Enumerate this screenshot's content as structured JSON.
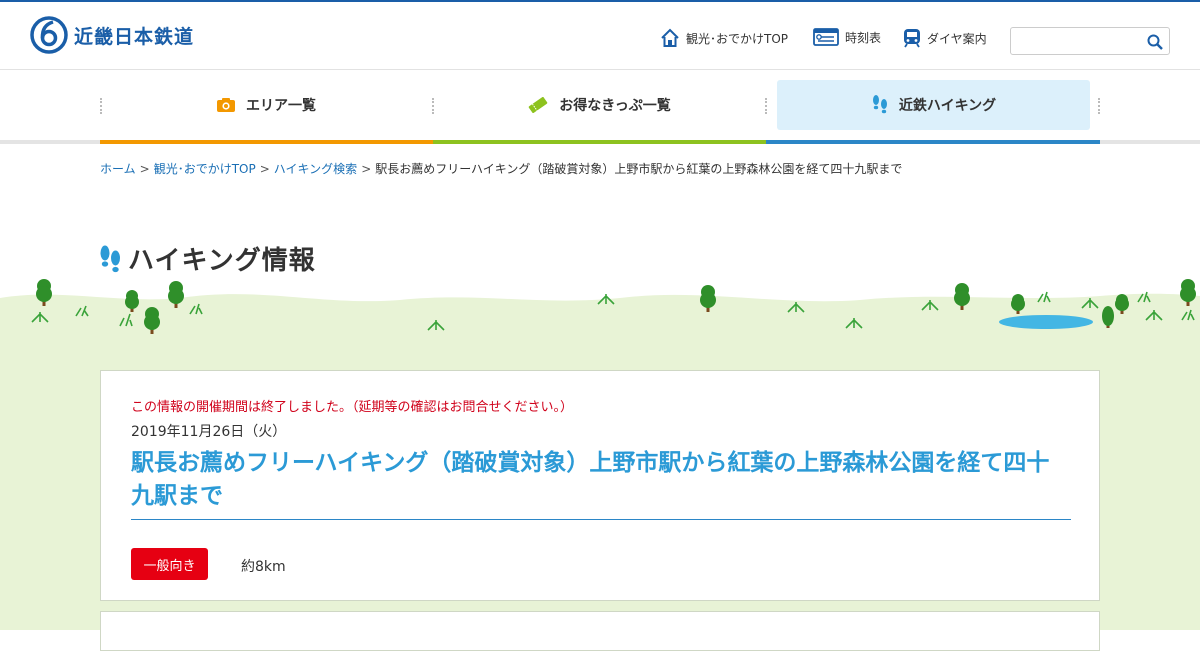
{
  "brand": {
    "name": "近畿日本鉄道"
  },
  "utility_nav": [
    {
      "label": "観光･おでかけTOP",
      "icon": "home-icon"
    },
    {
      "label": "時刻表",
      "icon": "timetable-icon"
    },
    {
      "label": "ダイヤ案内",
      "icon": "train-icon"
    }
  ],
  "search": {
    "placeholder": ""
  },
  "main_nav": [
    {
      "label": "エリア一覧",
      "icon": "camera-icon",
      "accent": "#f39800"
    },
    {
      "label": "お得なきっぷ一覧",
      "icon": "ticket-icon",
      "accent": "#8dc21f"
    },
    {
      "label": "近鉄ハイキング",
      "icon": "footprints-icon",
      "accent": "#2b86c7",
      "active": true
    }
  ],
  "breadcrumb": {
    "links": [
      "ホーム",
      "観光･おでかけTOP",
      "ハイキング検索"
    ],
    "current": "駅長お薦めフリーハイキング（踏破賞対象）上野市駅から紅葉の上野森林公園を経て四十九駅まで"
  },
  "page_title": "ハイキング情報",
  "event": {
    "notice": "この情報の開催期間は終了しました。（延期等の確認はお問合せください。）",
    "date": "2019年11月26日（火）",
    "title": "駅長お薦めフリーハイキング（踏破賞対象）上野市駅から紅葉の上野森林公園を経て四十九駅まで",
    "level": "一般向き",
    "distance": "約8km"
  },
  "colors": {
    "brand_blue": "#1a5ea8",
    "link_blue": "#1a6fb5",
    "title_blue": "#2b9ad6",
    "notice_red": "#d0021b",
    "badge_red": "#e60012",
    "active_nav_bg": "#dcf0fb",
    "grass": "#e8f3d6"
  }
}
